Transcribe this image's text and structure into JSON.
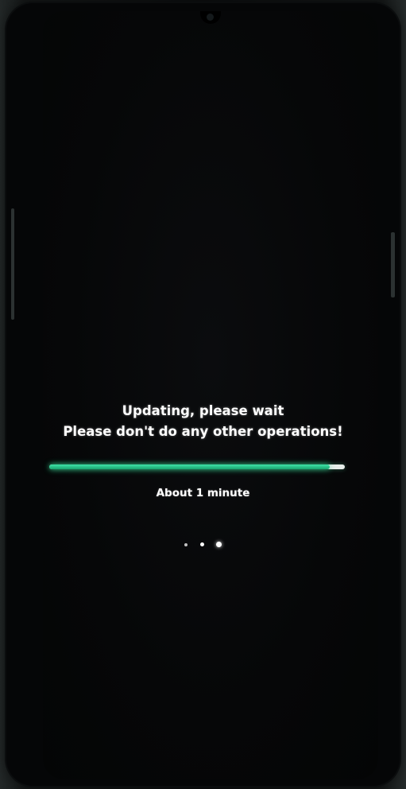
{
  "update_screen": {
    "title": "Updating, please wait",
    "warning": "Please don't do any other operations!",
    "progress_fraction": 0.95,
    "progress_color": "#1fbf80",
    "track_color": "#e6ece9",
    "eta_text": "About  1 minute",
    "loading_dots": 3
  }
}
